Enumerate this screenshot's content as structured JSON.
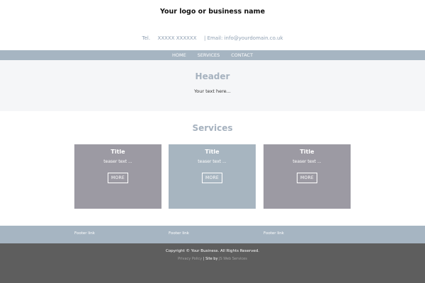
{
  "brand": {
    "name": "Your logo or business name"
  },
  "contact": {
    "tel_label": "Tel.",
    "tel_value": "XXXXX XXXXXX",
    "email_label": "| Email:",
    "email_value": "info@yourdomain.co.uk"
  },
  "nav": {
    "items": [
      {
        "label": "HOME"
      },
      {
        "label": "SERVICES"
      },
      {
        "label": "CONTACT"
      }
    ]
  },
  "hero": {
    "title": "Header",
    "subtitle": "Your text here..."
  },
  "services": {
    "title": "Services",
    "cards": [
      {
        "title": "Title",
        "teaser": "teaser text ...",
        "button": "MORE",
        "color": "#9c9aa3"
      },
      {
        "title": "Title",
        "teaser": "teaser text ...",
        "button": "MORE",
        "color": "#a7b5c0"
      },
      {
        "title": "Title",
        "teaser": "teaser text ...",
        "button": "MORE",
        "color": "#9c9aa3"
      }
    ]
  },
  "footer": {
    "links": [
      {
        "label": "Footer link"
      },
      {
        "label": "Footer link"
      },
      {
        "label": "Footer link"
      }
    ],
    "copyright": "Copyright © Your Business. All Rights Reserved.",
    "privacy": "Privacy Policy",
    "site_by_label": "| Site by",
    "site_by_link": "JS Web Services"
  },
  "colors": {
    "nav_bg": "#a6b5c2",
    "heading": "#a6b2bf",
    "hero_bg": "#f5f6f8",
    "footer_dark": "#5e5e5e"
  }
}
